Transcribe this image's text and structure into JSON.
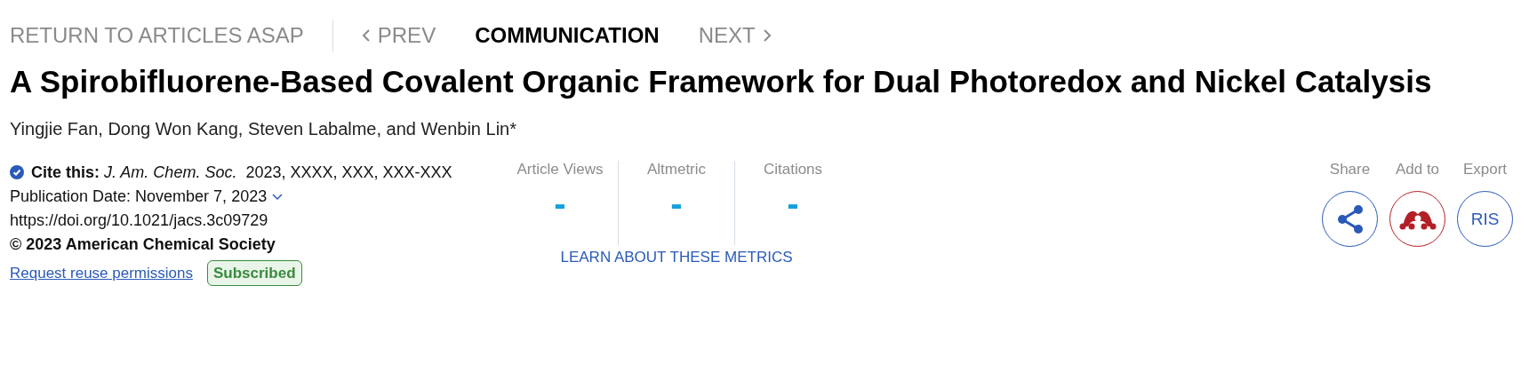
{
  "nav": {
    "back": "RETURN TO ARTICLES ASAP",
    "prev": "PREV",
    "type": "COMMUNICATION",
    "next": "NEXT"
  },
  "title": "A Spirobifluorene-Based Covalent Organic Framework for Dual Photoredox and Nickel Catalysis",
  "authors": "Yingjie Fan, Dong Won Kang, Steven Labalme, and Wenbin Lin*",
  "citation": {
    "text": "**Cite this:** *J. Am. Chem. Soc.*  2023, XXXX, XXX, XXX-XXX",
    "publication_date": "Publication Date: November 7, 2023",
    "doi": "https://doi.org/10.1021/jacs.3c09729",
    "copyright": "© 2023 American Chemical Society",
    "permissions_link": "Request reuse permissions",
    "access_badge": "Subscribed"
  },
  "metrics": [
    {
      "label": "Article Views",
      "value": "-"
    },
    {
      "label": "Altmetric",
      "value": "-"
    },
    {
      "label": "Citations",
      "value": "-"
    }
  ],
  "metrics_link": "LEARN ABOUT THESE METRICS",
  "actions": [
    {
      "label": "Share",
      "kind": "share"
    },
    {
      "label": "Add to",
      "kind": "mendeley"
    },
    {
      "label": "Export",
      "kind": "ris",
      "button_text": "RIS"
    }
  ]
}
